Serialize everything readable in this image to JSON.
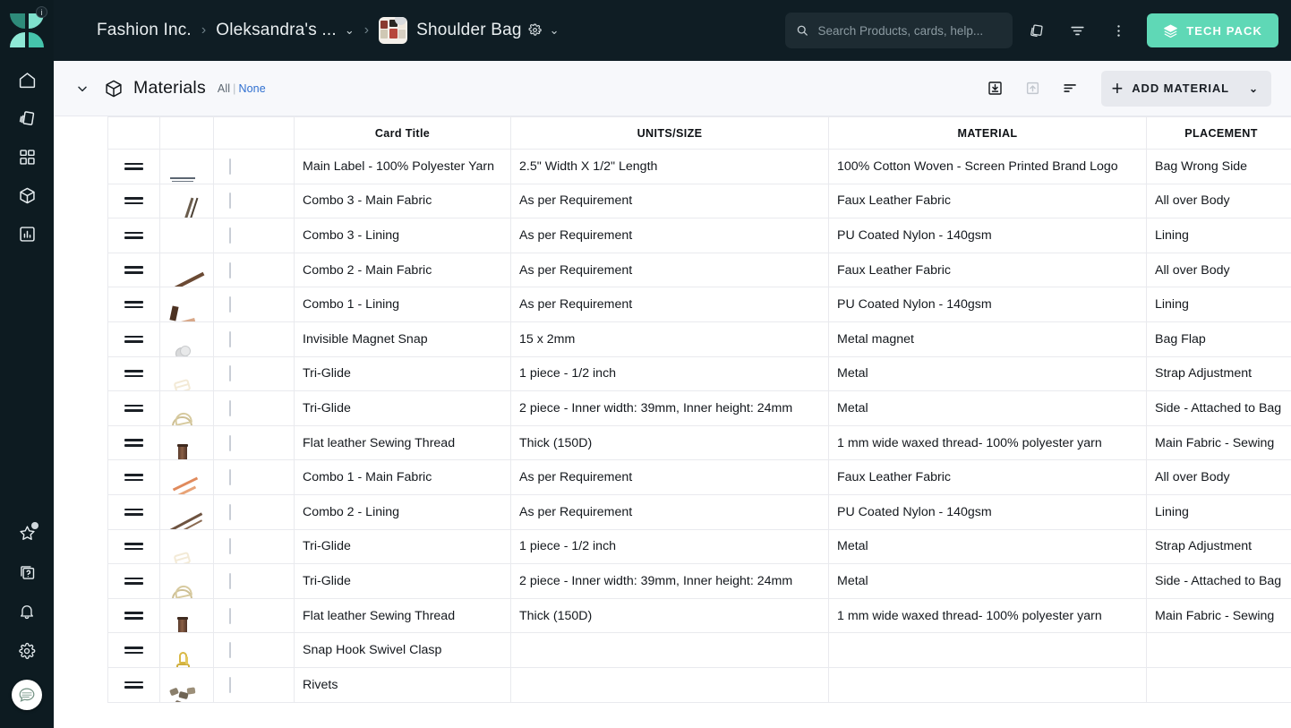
{
  "sidebar": {
    "logo_name": "techpacker-logo",
    "badge": "i",
    "items": [
      {
        "name": "home",
        "label": "Home"
      },
      {
        "name": "cards",
        "label": "Cards"
      },
      {
        "name": "dashboard",
        "label": "Dashboard"
      },
      {
        "name": "products",
        "label": "Products"
      },
      {
        "name": "reports",
        "label": "Reports"
      }
    ],
    "bottom_items": [
      {
        "name": "favorites",
        "label": "Favorites",
        "badge": true
      },
      {
        "name": "help",
        "label": "Help"
      },
      {
        "name": "notifications",
        "label": "Notifications"
      },
      {
        "name": "settings",
        "label": "Settings"
      }
    ],
    "chat_label": "Chat support"
  },
  "topbar": {
    "breadcrumb": [
      {
        "label": "Fashion Inc."
      },
      {
        "label": "Oleksandra's ..."
      },
      {
        "label": "Shoulder Bag"
      }
    ],
    "separator": "›",
    "caret": "⌄",
    "search": {
      "placeholder": "Search Products, cards, help...",
      "value": ""
    },
    "actions": [
      {
        "name": "copy-icon",
        "label": "Duplicate"
      },
      {
        "name": "filter-icon",
        "label": "Filter"
      },
      {
        "name": "more-vertical-icon",
        "label": "More options"
      }
    ],
    "tech_pack_label": "TECH PACK"
  },
  "section": {
    "title": "Materials",
    "select_all_label": "All",
    "select_divider": "|",
    "select_none_label": "None",
    "toolbar": [
      {
        "name": "import-icon",
        "label": "Import"
      },
      {
        "name": "export-icon",
        "label": "Export"
      },
      {
        "name": "sort-icon",
        "label": "Sort"
      }
    ],
    "add_label": "ADD MATERIAL",
    "add_plus": "+",
    "add_caret": "⌄"
  },
  "table": {
    "columns": [
      "",
      "",
      "",
      "Card Title",
      "UNITS/SIZE",
      "MATERIAL",
      "PLACEMENT",
      ""
    ],
    "columns_icon": "columns-icon",
    "rows": [
      {
        "title": "Main Label - 100% Polyester Yarn",
        "units": "2.5\" Width X 1/2\" Length",
        "material": "100% Cotton Woven - Screen Printed Brand Logo",
        "placement": "Bag Wrong Side",
        "thumb": "label-black-white"
      },
      {
        "title": "Combo 3 - Main Fabric",
        "units": "As per Requirement",
        "material": "Faux Leather Fabric",
        "placement": "All over Body",
        "thumb": "fabric-taupe"
      },
      {
        "title": "Combo 3 - Lining",
        "units": "As per Requirement",
        "material": "PU Coated Nylon - 140gsm",
        "placement": "Lining",
        "thumb": "fabric-beige"
      },
      {
        "title": "Combo 2 - Main Fabric",
        "units": "As per Requirement",
        "material": "Faux Leather Fabric",
        "placement": "All over Body",
        "thumb": "fabric-dark-brown"
      },
      {
        "title": "Combo 1 - Lining",
        "units": "As per Requirement",
        "material": "PU Coated Nylon - 140gsm",
        "placement": "Lining",
        "thumb": "fabric-copper"
      },
      {
        "title": "Invisible Magnet Snap",
        "units": "15 x 2mm",
        "material": "Metal magnet",
        "placement": "Bag Flap",
        "thumb": "magnet-snap"
      },
      {
        "title": "Tri-Glide",
        "units": "1 piece - 1/2 inch",
        "material": "Metal",
        "placement": "Strap Adjustment",
        "thumb": "triglide-tan"
      },
      {
        "title": "Tri-Glide",
        "units": "2 piece - Inner width: 39mm, Inner height: 24mm",
        "material": "Metal",
        "placement": "Side - Attached to Bag",
        "thumb": "triglide-outline"
      },
      {
        "title": "Flat leather Sewing Thread",
        "units": "Thick (150D)",
        "material": "1 mm wide waxed thread- 100% polyester yarn",
        "placement": "Main Fabric - Sewing",
        "thumb": "thread-spool"
      },
      {
        "title": "Combo 1 - Main Fabric",
        "units": "As per Requirement",
        "material": "Faux Leather Fabric",
        "placement": "All over Body",
        "thumb": "fabric-rust"
      },
      {
        "title": "Combo 2 - Lining",
        "units": "As per Requirement",
        "material": "PU Coated Nylon - 140gsm",
        "placement": "Lining",
        "thumb": "fabric-espresso"
      },
      {
        "title": "Tri-Glide",
        "units": "1 piece - 1/2 inch",
        "material": "Metal",
        "placement": "Strap Adjustment",
        "thumb": "triglide-tan"
      },
      {
        "title": "Tri-Glide",
        "units": "2 piece - Inner width: 39mm, Inner height: 24mm",
        "material": "Metal",
        "placement": "Side - Attached to Bag",
        "thumb": "triglide-outline"
      },
      {
        "title": "Flat leather Sewing Thread",
        "units": "Thick (150D)",
        "material": "1 mm wide waxed thread- 100% polyester yarn",
        "placement": "Main Fabric - Sewing",
        "thumb": "thread-spool"
      },
      {
        "title": "Snap Hook Swivel Clasp",
        "units": "",
        "material": "",
        "placement": "",
        "thumb": "snap-hook-gold"
      },
      {
        "title": "Rivets",
        "units": "",
        "material": "",
        "placement": "",
        "thumb": "rivets"
      }
    ]
  },
  "colors": {
    "brand_dark": "#0d1b21",
    "accent_mint": "#5fd8b6",
    "section_bg": "#f7f8fb",
    "border": "#e9eaee",
    "link_blue": "#2f6fd0"
  }
}
